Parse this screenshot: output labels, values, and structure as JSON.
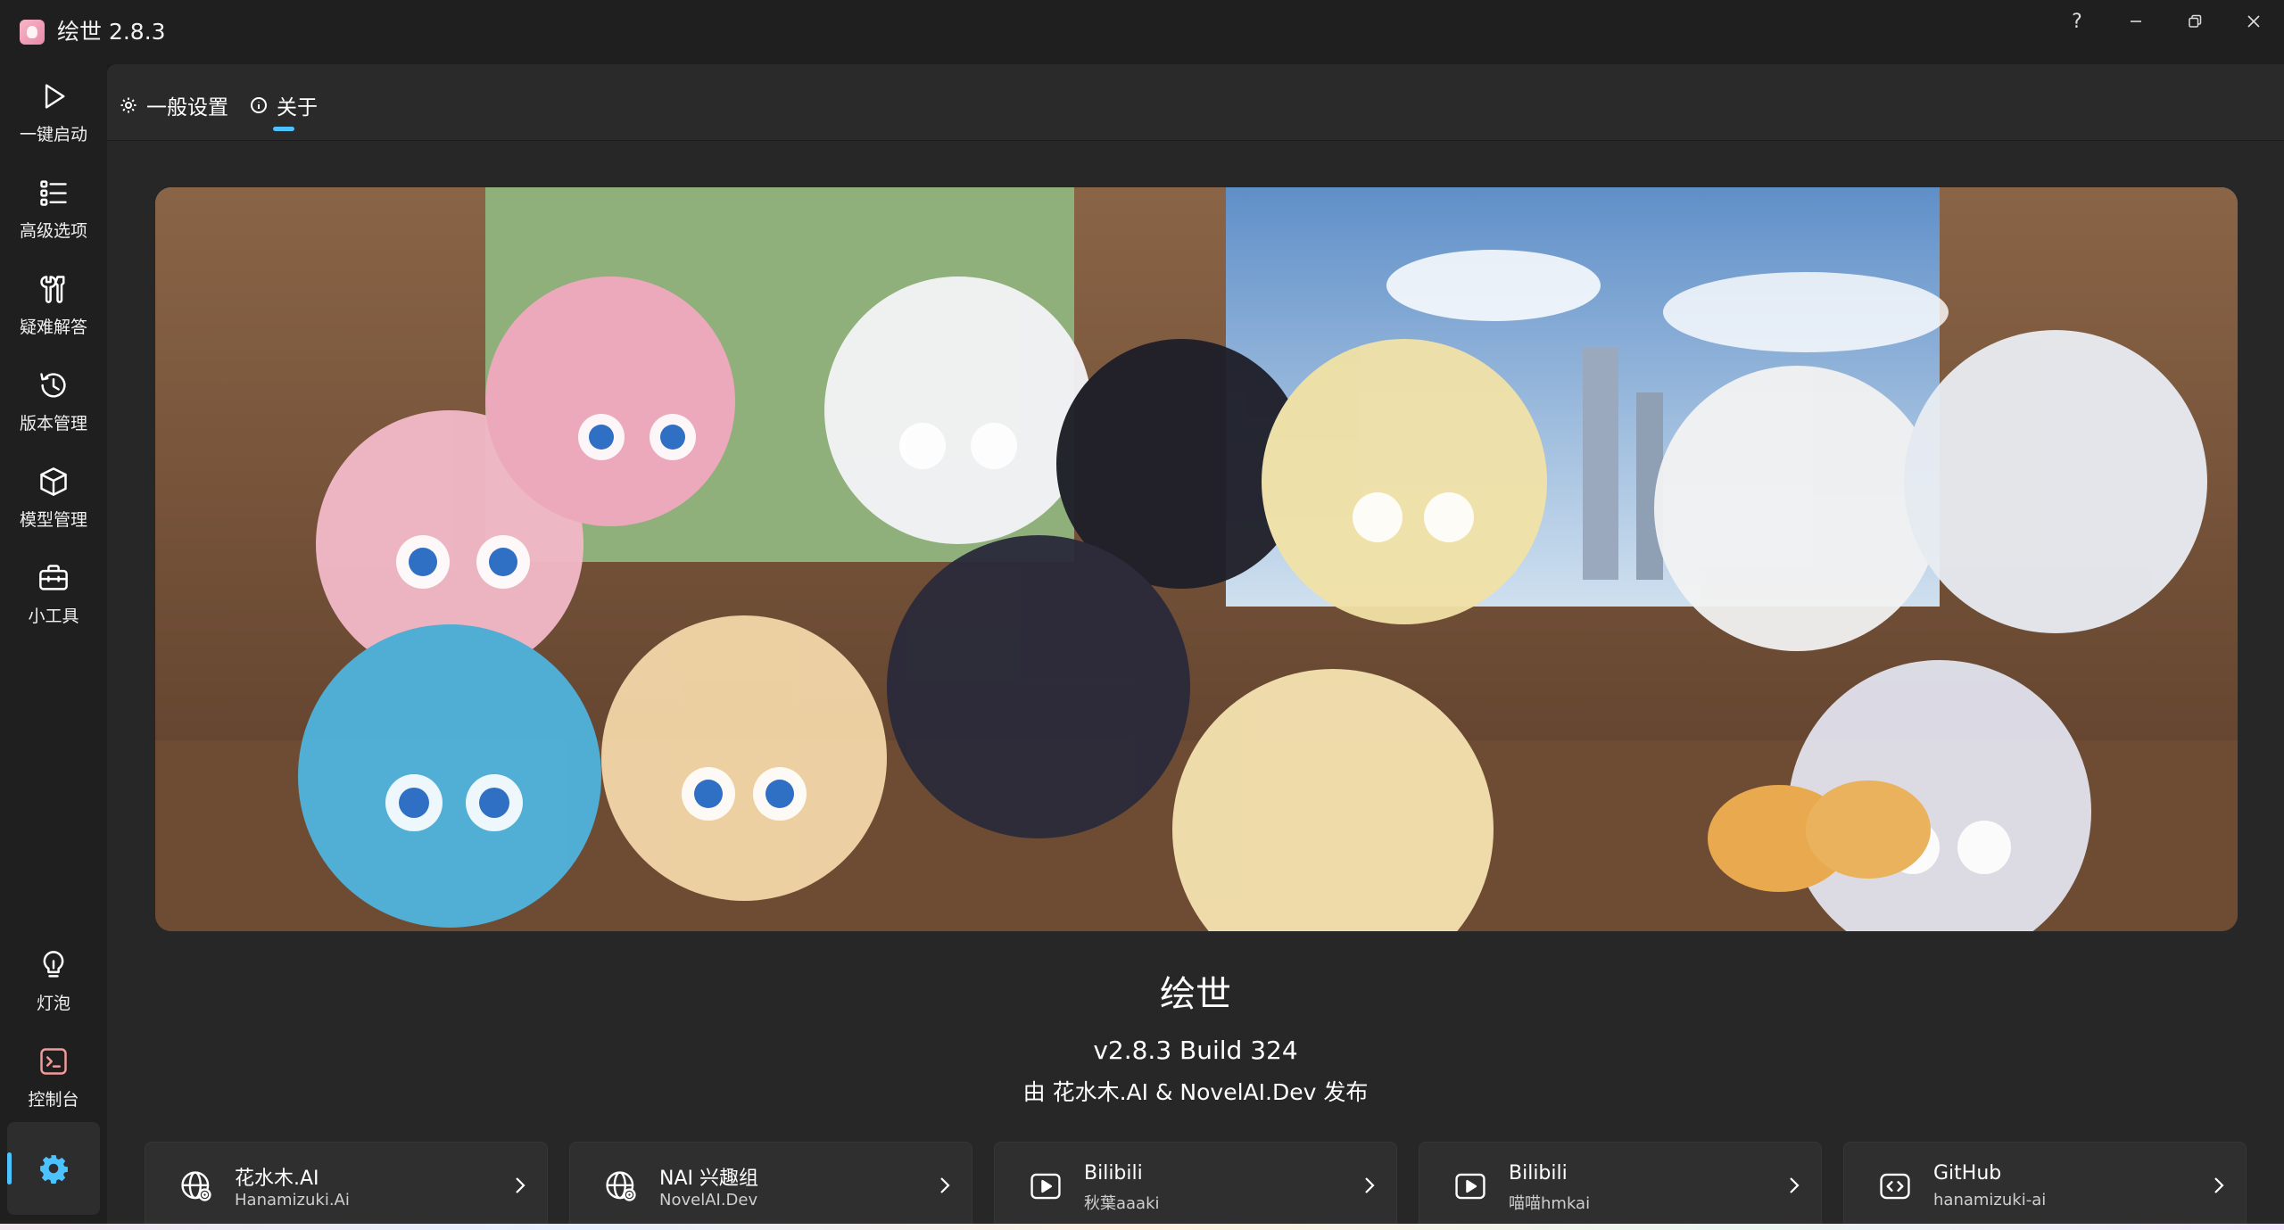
{
  "window": {
    "title": "绘世 2.8.3",
    "controls": {
      "help": "?",
      "minimize": "minimize-icon",
      "maximize": "restore-icon",
      "close": "close-icon"
    }
  },
  "sidebar": {
    "items": [
      {
        "label": "一键启动",
        "icon": "play-icon"
      },
      {
        "label": "高级选项",
        "icon": "list-icon"
      },
      {
        "label": "疑难解答",
        "icon": "wrench-icon"
      },
      {
        "label": "版本管理",
        "icon": "history-icon"
      },
      {
        "label": "模型管理",
        "icon": "cube-icon"
      },
      {
        "label": "小工具",
        "icon": "toolbox-icon"
      }
    ],
    "bottom_items": [
      {
        "label": "灯泡",
        "icon": "lightbulb-icon"
      },
      {
        "label": "控制台",
        "icon": "terminal-icon"
      }
    ],
    "settings": {
      "icon": "gear-icon",
      "active": true
    }
  },
  "tabs": [
    {
      "label": "一般设置",
      "icon": "gear-icon"
    },
    {
      "label": "关于",
      "icon": "info-icon",
      "active": true
    }
  ],
  "about": {
    "name": "绘世",
    "version": "v2.8.3 Build 324",
    "publisher": "由 花水木.AI & NovelAI.Dev 发布"
  },
  "links": [
    {
      "title": "花水木.AI",
      "subtitle": "Hanamizuki.Ai",
      "icon": "globe-icon"
    },
    {
      "title": "NAI 兴趣组",
      "subtitle": "NovelAI.Dev",
      "icon": "globe-icon"
    },
    {
      "title": "Bilibili",
      "subtitle": "秋葉aaaki",
      "icon": "video-icon"
    },
    {
      "title": "Bilibili",
      "subtitle": "喵喵hmkai",
      "icon": "video-icon"
    },
    {
      "title": "GitHub",
      "subtitle": "hanamizuki-ai",
      "icon": "code-icon"
    }
  ],
  "colors": {
    "accent": "#4cc2ff",
    "background": "#1c1c1c",
    "surface": "#272727",
    "card": "#2f2f2f"
  }
}
